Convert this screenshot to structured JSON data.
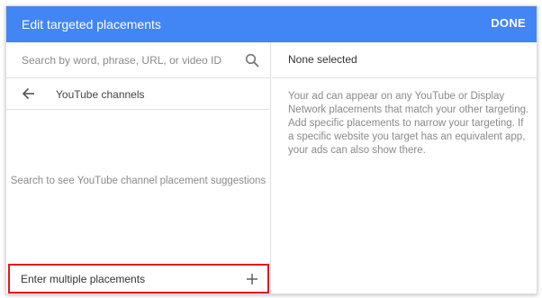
{
  "header": {
    "title": "Edit targeted placements",
    "done_label": "DONE",
    "bg_color": "#4285f4"
  },
  "search": {
    "placeholder": "Search by word, phrase, URL, or video ID",
    "value": "",
    "icon": "search-icon"
  },
  "nav": {
    "back_icon": "arrow-back-icon",
    "label": "YouTube channels"
  },
  "hint": "Search to see YouTube channel placement suggestions",
  "multi": {
    "label": "Enter multiple placements",
    "icon": "plus-icon",
    "highlight_color": "#e0191c"
  },
  "selection": {
    "status": "None selected",
    "info": "Your ad can appear on any YouTube or Display Network placements that match your other targeting. Add specific placements to narrow your targeting. If a specific website you target has an equivalent app, your ads can also show there."
  }
}
